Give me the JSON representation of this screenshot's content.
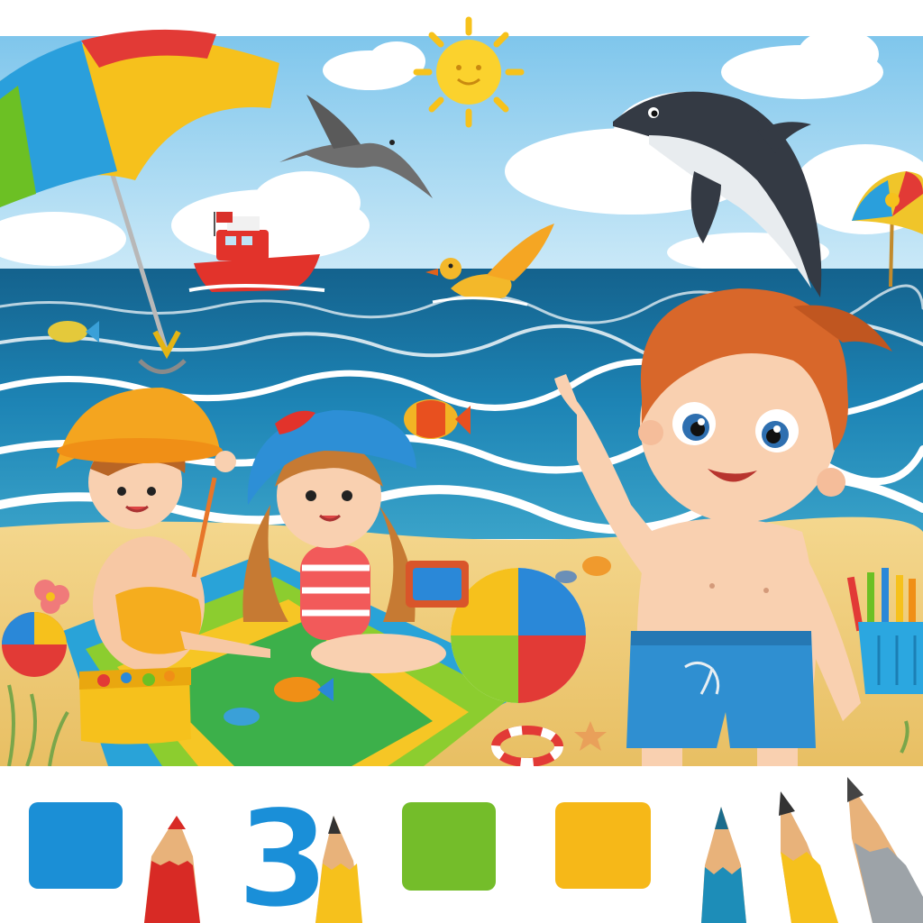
{
  "palette": {
    "sky": "#9fd6f2",
    "sea": "#1d7fb0",
    "sea_deep": "#136a96",
    "sand": "#f2cd7a",
    "swatch_blue": "#1b8fd6",
    "swatch_green": "#74bd2a",
    "swatch_yellow": "#f6b818",
    "number_blue": "#1a8fd8"
  },
  "icons": [
    "sun-icon",
    "dolphin-icon",
    "manta-ray-icon",
    "boat-icon",
    "bird-icon",
    "umbrella-icon",
    "beach-ball-icon",
    "pencil-icon",
    "starfish-icon",
    "life-ring-icon"
  ],
  "bottom_strip": {
    "number_label": "3"
  }
}
